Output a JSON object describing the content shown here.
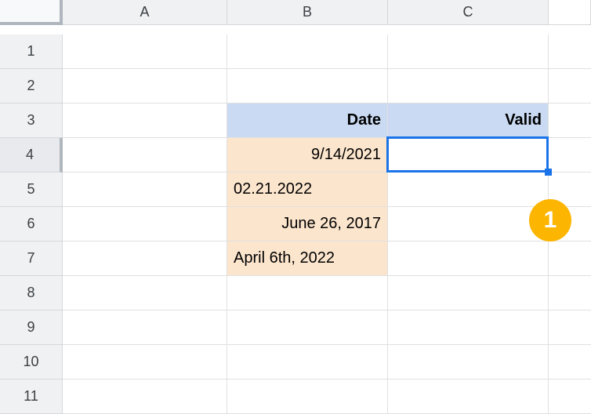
{
  "columns": {
    "A": "A",
    "B": "B",
    "C": "C"
  },
  "rows": {
    "1": "1",
    "2": "2",
    "3": "3",
    "4": "4",
    "5": "5",
    "6": "6",
    "7": "7",
    "8": "8",
    "9": "9",
    "10": "10",
    "11": "11"
  },
  "headers": {
    "B3": "Date",
    "C3": "Valid"
  },
  "cells": {
    "B4": "9/14/2021",
    "B5": "02.21.2022",
    "B6": "June 26, 2017",
    "B7": "April 6th, 2022"
  },
  "selected_cell": "C4",
  "annotation": {
    "label": "1"
  }
}
